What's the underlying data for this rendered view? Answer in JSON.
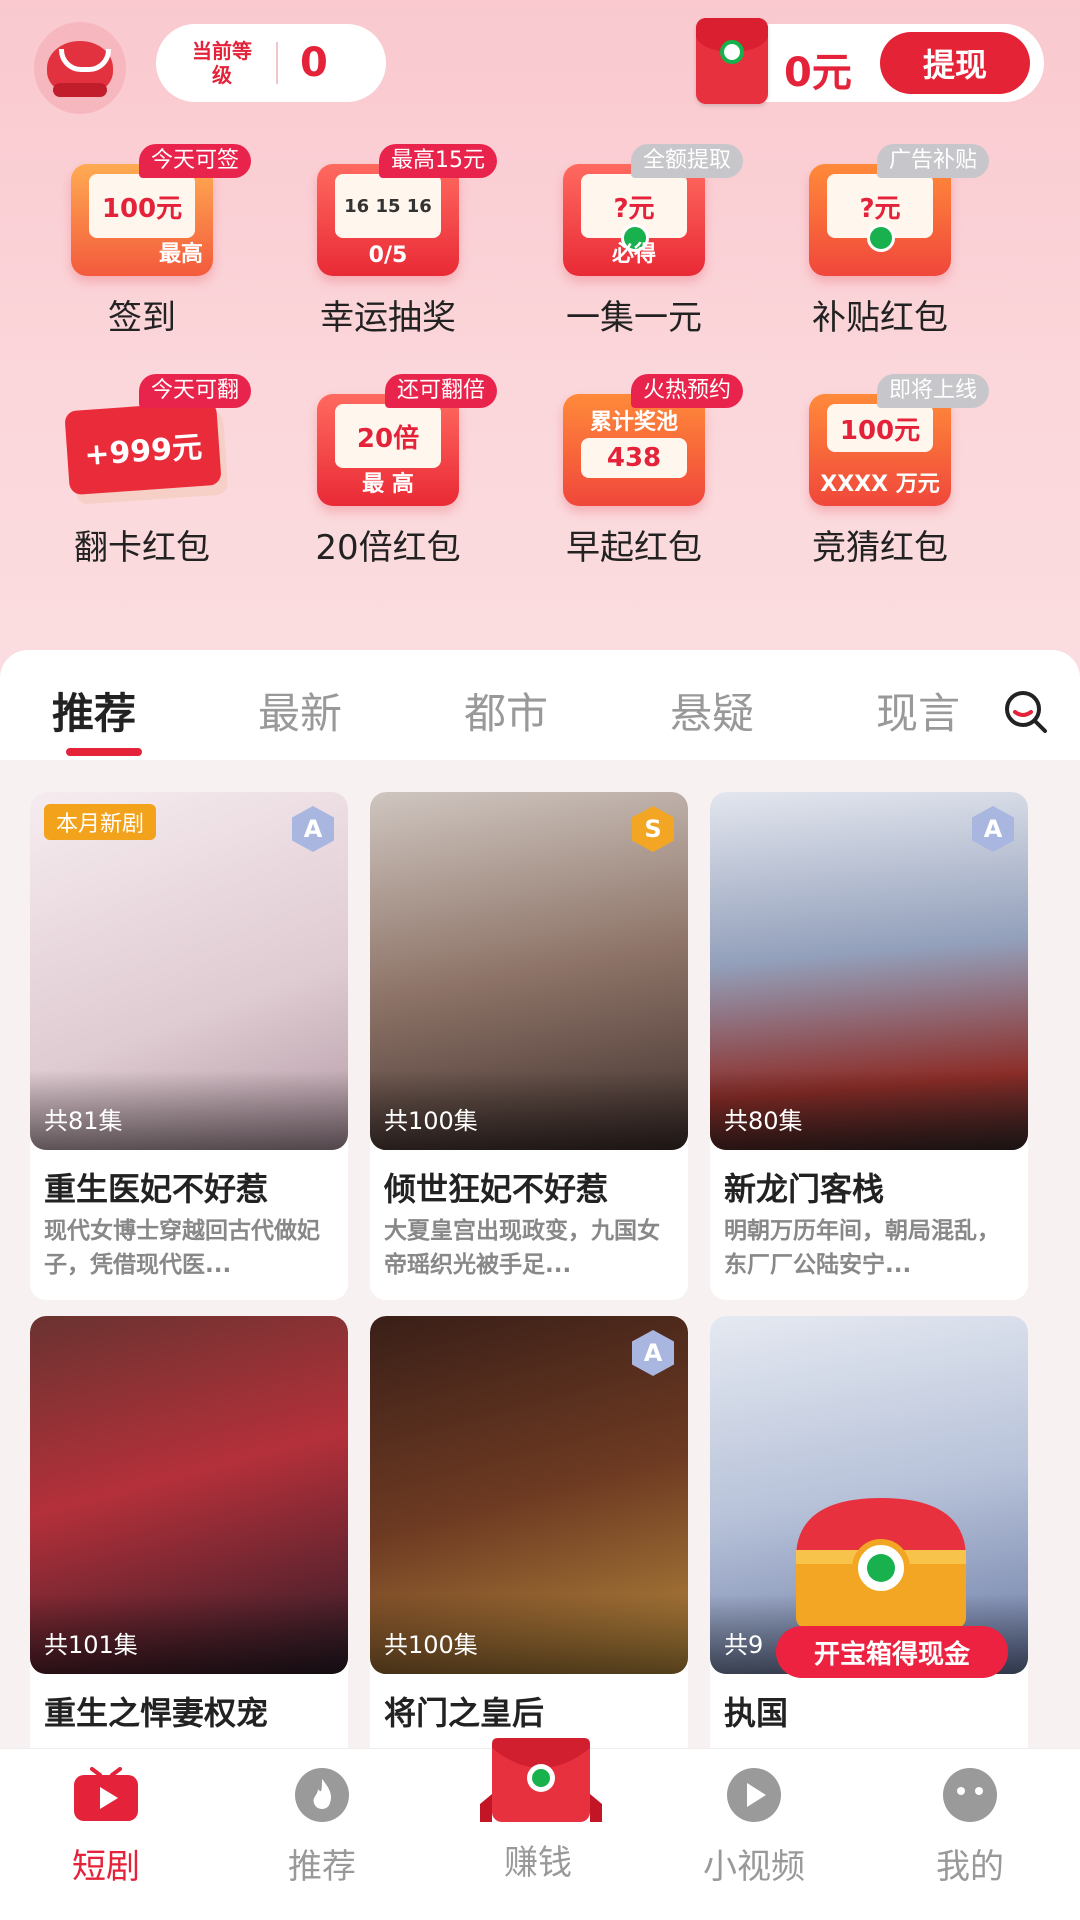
{
  "header": {
    "level_label": "当前等级",
    "level_value": "0",
    "cash_amount": "0元",
    "withdraw_label": "提现"
  },
  "features": [
    {
      "label": "签到",
      "tag": "今天可签",
      "art": "100元",
      "sub": "最高"
    },
    {
      "label": "幸运抽奖",
      "tag": "最高15元",
      "art": "0/5"
    },
    {
      "label": "一集一元",
      "tag": "全额提取",
      "art": "?元",
      "sub": "必得"
    },
    {
      "label": "补贴红包",
      "tag": "广告补贴",
      "art": "?元"
    },
    {
      "label": "翻卡红包",
      "tag": "今天可翻",
      "art": "+999元"
    },
    {
      "label": "20倍红包",
      "tag": "还可翻倍",
      "art": "20倍",
      "sub": "最 高"
    },
    {
      "label": "早起红包",
      "tag": "火热预约",
      "art": "438",
      "sub": "累计奖池"
    },
    {
      "label": "竞猜红包",
      "tag": "即将上线",
      "art": "100元",
      "sub": "XXXX 万元"
    }
  ],
  "tabs": [
    "推荐",
    "最新",
    "都市",
    "悬疑",
    "现言"
  ],
  "dramas": [
    {
      "title": "重生医妃不好惹",
      "episodes": "共81集",
      "desc": "现代女博士穿越回古代做妃子，凭借现代医...",
      "rank": "A",
      "badge": "本月新剧",
      "colors": [
        "#f4e6ea",
        "#d9c5cc",
        "#b99da6"
      ]
    },
    {
      "title": "倾世狂妃不好惹",
      "episodes": "共100集",
      "desc": "大夏皇宫出现政变，九国女帝瑶织光被手足...",
      "rank": "S",
      "colors": [
        "#c9bfb8",
        "#8a6f64",
        "#4b3a36"
      ]
    },
    {
      "title": "新龙门客栈",
      "episodes": "共80集",
      "desc": "明朝万历年间，朝局混乱，东厂厂公陆安宁...",
      "rank": "A",
      "colors": [
        "#d9dde6",
        "#7f8ba5",
        "#8b2a26"
      ]
    },
    {
      "title": "重生之悍妻权宠",
      "episodes": "共101集",
      "desc": "",
      "colors": [
        "#5b2a2a",
        "#b2303a",
        "#2a1c28"
      ]
    },
    {
      "title": "将门之皇后",
      "episodes": "共100集",
      "desc": "",
      "rank": "A",
      "colors": [
        "#3a1f18",
        "#6d3a22",
        "#b88a3d"
      ]
    },
    {
      "title": "执国",
      "episodes": "共9",
      "desc": "",
      "colors": [
        "#dfe4ee",
        "#b7c2d9",
        "#6a7aa4"
      ],
      "promo": "开宝箱得现金"
    }
  ],
  "nav": [
    {
      "label": "短剧",
      "icon": "tv-icon"
    },
    {
      "label": "推荐",
      "icon": "fire-icon"
    },
    {
      "label": "赚钱",
      "icon": "red-envelope-icon"
    },
    {
      "label": "小视频",
      "icon": "play-icon"
    },
    {
      "label": "我的",
      "icon": "profile-icon"
    }
  ],
  "colors": {
    "accent": "#e4233a",
    "tag": "#e9244c"
  }
}
